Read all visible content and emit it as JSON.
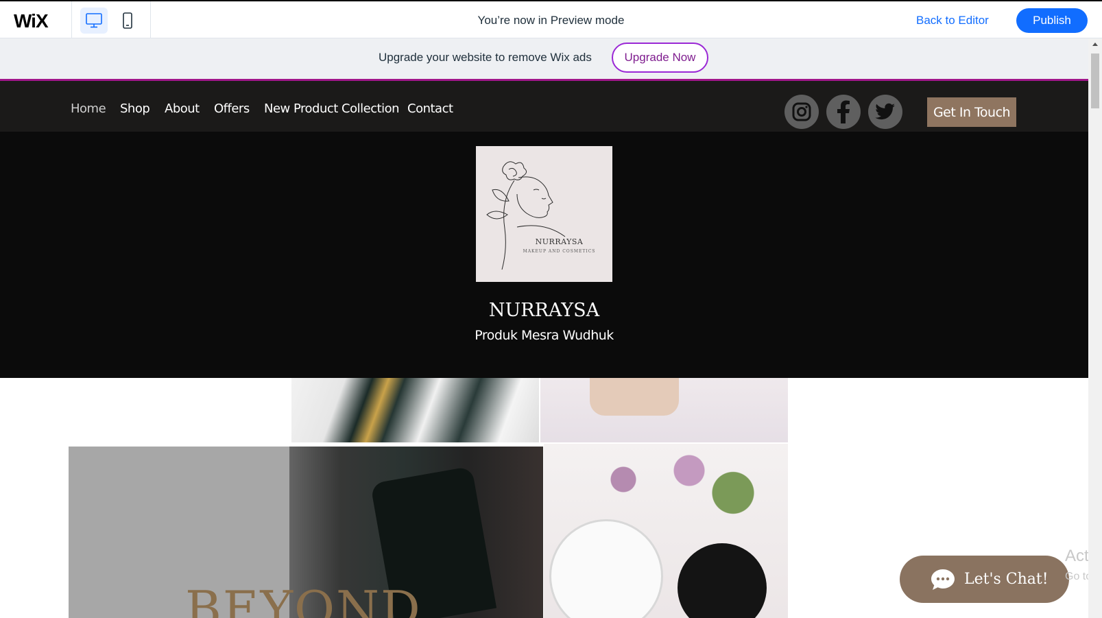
{
  "editor_bar": {
    "logo": "WiX",
    "desktop_icon": "desktop-icon",
    "mobile_icon": "mobile-icon",
    "preview_text": "You’re now in Preview mode",
    "back_to_editor": "Back to Editor",
    "publish": "Publish"
  },
  "ad_bar": {
    "text": "Upgrade your website to remove Wix ads",
    "button": "Upgrade Now"
  },
  "site_nav": {
    "items": [
      "Home",
      "Shop",
      "About",
      "Offers",
      "New Product Collection",
      "Contact"
    ],
    "social": [
      "instagram-icon",
      "facebook-icon",
      "twitter-icon"
    ],
    "cta": "Get In Touch"
  },
  "hero": {
    "logo_name": "NURRAYSA",
    "logo_tagline": "MAKEUP AND COSMETICS",
    "title": "NURRAYSA",
    "subtitle": "Produk Mesra Wudhuk"
  },
  "gallery": {
    "overlay_text": "BEYOND"
  },
  "chat": {
    "label": "Let's Chat!"
  },
  "os_watermark": {
    "line1": "Activ",
    "line2": "Go to S"
  },
  "colors": {
    "wix_blue": "#116dff",
    "upgrade_border": "#9a27d5",
    "nav_bg": "#1b1a19",
    "accent_brown": "#8f7560"
  }
}
